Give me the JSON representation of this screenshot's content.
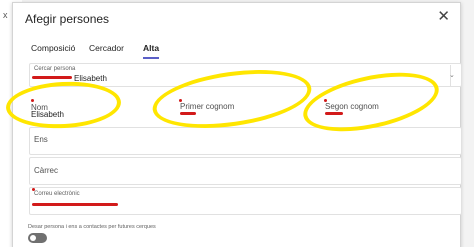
{
  "dialog": {
    "title": "Afegir persones"
  },
  "tabs": [
    {
      "label": "Composició",
      "active": false
    },
    {
      "label": "Cercador",
      "active": false
    },
    {
      "label": "Alta",
      "active": true
    }
  ],
  "search": {
    "label": "Cercar persona",
    "value": "Elisabeth"
  },
  "name_row": {
    "name_label": "Nom",
    "name_value": "Elisabeth",
    "surname1_label": "Primer cognom",
    "surname2_label": "Segon cognom"
  },
  "fields": {
    "ens_placeholder": "Ens",
    "carrec_placeholder": "Càrrec",
    "email_label": "Correu electrònic"
  },
  "optin": {
    "label": "Desar persona i ens a contactes per futures cerques",
    "enabled": false
  },
  "colors": {
    "accent": "#5b5fc7",
    "highlight": "#ffe600",
    "redaction": "#d21a1a"
  },
  "icons": {
    "close": "close-icon",
    "dropdown": "chevron-down-icon"
  }
}
